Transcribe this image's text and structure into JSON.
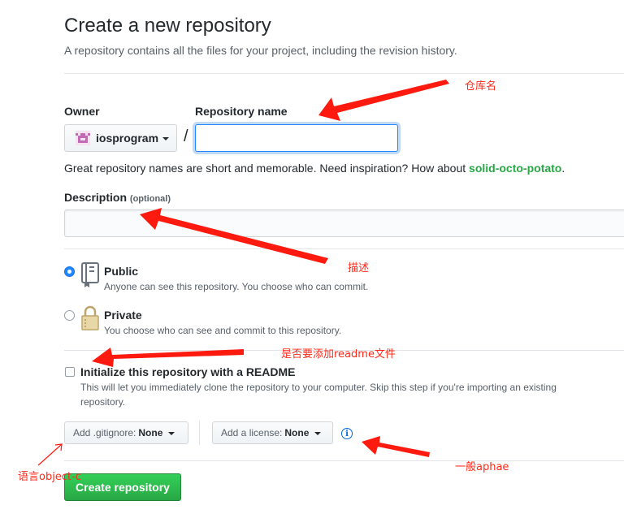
{
  "header": {
    "title": "Create a new repository",
    "subtitle": "A repository contains all the files for your project, including the revision history."
  },
  "owner": {
    "label": "Owner",
    "value": "iosprogram"
  },
  "repo_name": {
    "label": "Repository name",
    "value": "",
    "separator": "/"
  },
  "hint": {
    "text": "Great repository names are short and memorable. Need inspiration? How about ",
    "suggestion": "solid-octo-potato",
    "end": "."
  },
  "description": {
    "label": "Description",
    "optional": "(optional)",
    "value": ""
  },
  "visibility": {
    "public": {
      "title": "Public",
      "note": "Anyone can see this repository. You choose who can commit.",
      "selected": true
    },
    "private": {
      "title": "Private",
      "note": "You choose who can see and commit to this repository.",
      "selected": false
    }
  },
  "readme": {
    "title": "Initialize this repository with a README",
    "note_line1": "This will let you immediately clone the repository to your computer. Skip this step if you're importing an existing",
    "note_line2": "repository.",
    "checked": false
  },
  "gitignore": {
    "label": "Add .gitignore:",
    "value": "None"
  },
  "license": {
    "label": "Add a license:",
    "value": "None"
  },
  "info_icon": "info-icon",
  "create_button": "Create repository",
  "annotations": {
    "repo_name": "仓库名",
    "description": "描述",
    "readme": "是否要添加readme文件",
    "gitignore": "语言object-c",
    "license": "一般aphae"
  },
  "colors": {
    "accent_blue": "#2188ff",
    "create_green": "#28a745",
    "suggestion_green": "#28a745",
    "annotation_red": "#ff2a1a"
  }
}
